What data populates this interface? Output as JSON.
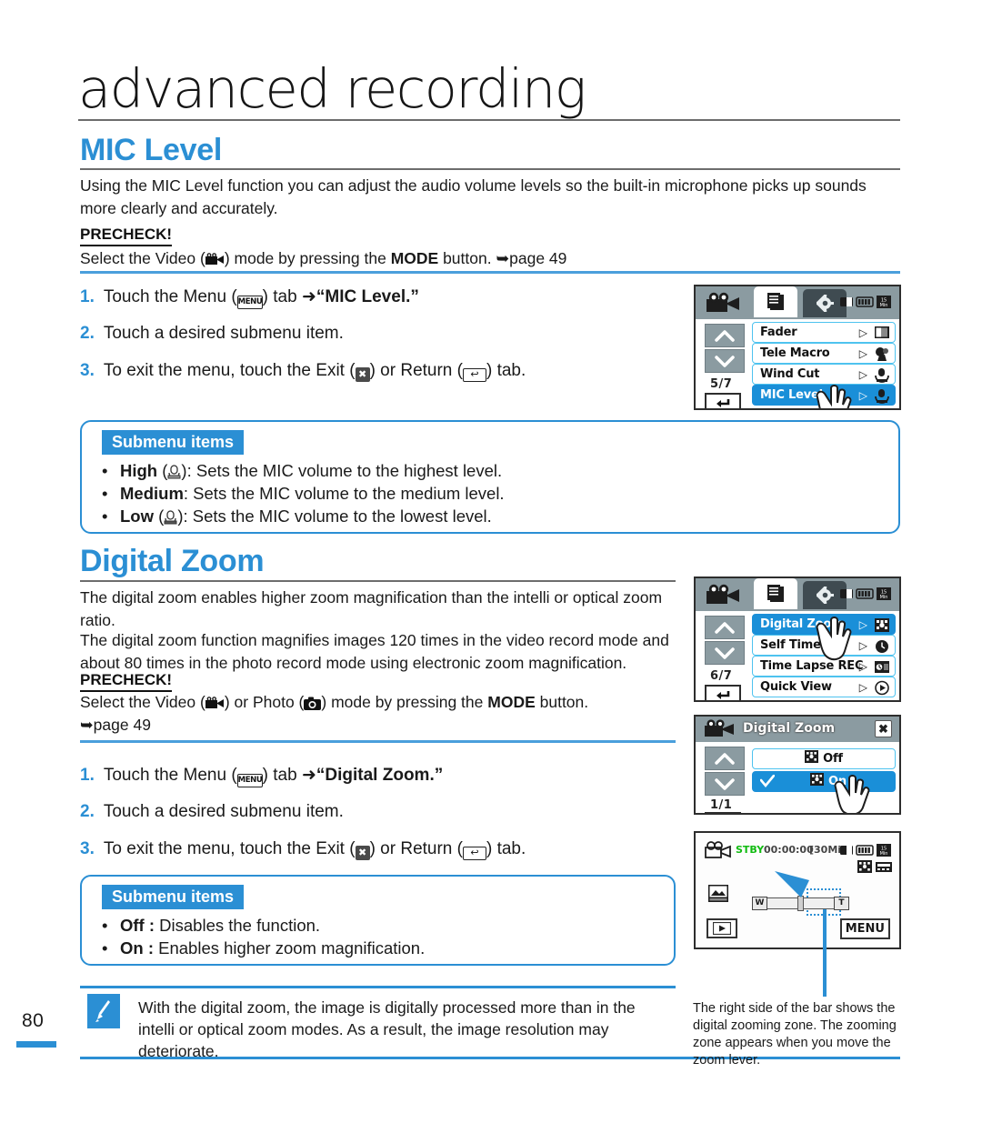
{
  "page": {
    "number": "80",
    "chapter_title": "advanced recording"
  },
  "sections": [
    {
      "id": "mic_level",
      "title": "MIC Level",
      "intro": "Using the MIC Level function you can adjust the audio volume levels so the built-in microphone picks up sounds more clearly and accurately.",
      "precheck_label": "PRECHECK!",
      "precheck_text_a": "Select the Video (",
      "precheck_text_b": ") mode by pressing the ",
      "precheck_mode": "MODE",
      "precheck_text_c": " button. ",
      "precheck_page": "page 49",
      "steps": [
        {
          "num": "1.",
          "a": "Touch the Menu (",
          "menu_icon": "MENU",
          "b": ") tab ",
          "arrow": "➜",
          "quoted": "“MIC Level.”"
        },
        {
          "num": "2.",
          "a": "Touch a desired submenu item."
        },
        {
          "num": "3.",
          "a": "To exit the menu, touch the Exit (",
          "exit_icon": "✖",
          "b": ") or Return (",
          "return_icon": "↩",
          "c": ") tab."
        }
      ],
      "submenu_badge": "Submenu items",
      "submenu_items": [
        {
          "term": "High",
          "has_icon": true,
          "desc": ": Sets the MIC volume to the highest level."
        },
        {
          "term": "Medium",
          "has_icon": false,
          "desc": ": Sets the MIC volume to the medium level."
        },
        {
          "term": "Low",
          "has_icon": true,
          "desc": ": Sets the MIC volume to the lowest level."
        }
      ]
    },
    {
      "id": "digital_zoom",
      "title": "Digital Zoom",
      "intro_line1": "The digital zoom enables higher zoom magnification than the intelli or optical zoom ratio.",
      "intro_line2": "The digital zoom function magnifies images 120 times in the video record mode and about 80 times in the photo record mode using electronic zoom magnification.",
      "precheck_label": "PRECHECK!",
      "precheck_text_a": "Select the Video (",
      "precheck_text_b": ") or Photo (",
      "precheck_text_c": ") mode by pressing the ",
      "precheck_mode": "MODE",
      "precheck_text_d": " button.",
      "precheck_page": "page 49",
      "steps": [
        {
          "num": "1.",
          "a": "Touch the Menu (",
          "menu_icon": "MENU",
          "b": ") tab ",
          "arrow": "➜",
          "quoted": "“Digital Zoom.”"
        },
        {
          "num": "2.",
          "a": "Touch a desired submenu item."
        },
        {
          "num": "3.",
          "a": "To exit the menu, touch the Exit (",
          "exit_icon": "✖",
          "b": ") or Return (",
          "return_icon": "↩",
          "c": ") tab."
        }
      ],
      "submenu_badge": "Submenu items",
      "submenu_items": [
        {
          "term": "Off :",
          "desc": " Disables the function."
        },
        {
          "term": "On :",
          "desc": " Enables higher zoom magnification."
        }
      ]
    }
  ],
  "note": {
    "icon_name": "note-pen-icon",
    "text": "With the digital zoom, the image is digitally processed more than in the intelli or optical zoom modes. As a result, the image resolution may deteriorate."
  },
  "lcd_mic_menu": {
    "page_indicator": "5/7",
    "tabs": [
      "camcorder-icon",
      "menu-list-icon",
      "settings-gear-icon"
    ],
    "status_icons": [
      "memory-card-icon",
      "battery-icon",
      "record-time-icon"
    ],
    "items": [
      {
        "label": "Fader",
        "selected": false
      },
      {
        "label": "Tele Macro",
        "selected": false
      },
      {
        "label": "Wind Cut",
        "selected": false
      },
      {
        "label": "MIC Level",
        "selected": true
      }
    ]
  },
  "lcd_zoom_menu": {
    "page_indicator": "6/7",
    "items": [
      {
        "label": "Digital Zoom",
        "selected": true
      },
      {
        "label": "Self Timer",
        "selected": false
      },
      {
        "label": "Time Lapse REC",
        "selected": false
      },
      {
        "label": "Quick View",
        "selected": false
      }
    ]
  },
  "lcd_zoom_submenu": {
    "title": "Digital Zoom",
    "close_label": "✖",
    "page_indicator": "1/1",
    "items": [
      {
        "label": "Off",
        "selected": false,
        "checked": false
      },
      {
        "label": "On",
        "selected": true,
        "checked": true
      }
    ]
  },
  "lcd_record": {
    "status": "STBY",
    "timecode": "00:00:00",
    "remaining": "[30Min]",
    "zoom_w": "W",
    "zoom_t": "T",
    "menu_label": "MENU"
  },
  "zoom_caption": "The right side of the bar shows the digital zooming zone. The zooming zone appears when you move the zoom lever.",
  "colors": {
    "accent_blue": "#2b8fd4",
    "lcd_select_blue": "#1a8fd8",
    "lcd_bar_grey": "#8b9ba1",
    "stby_green": "#11bb11"
  }
}
